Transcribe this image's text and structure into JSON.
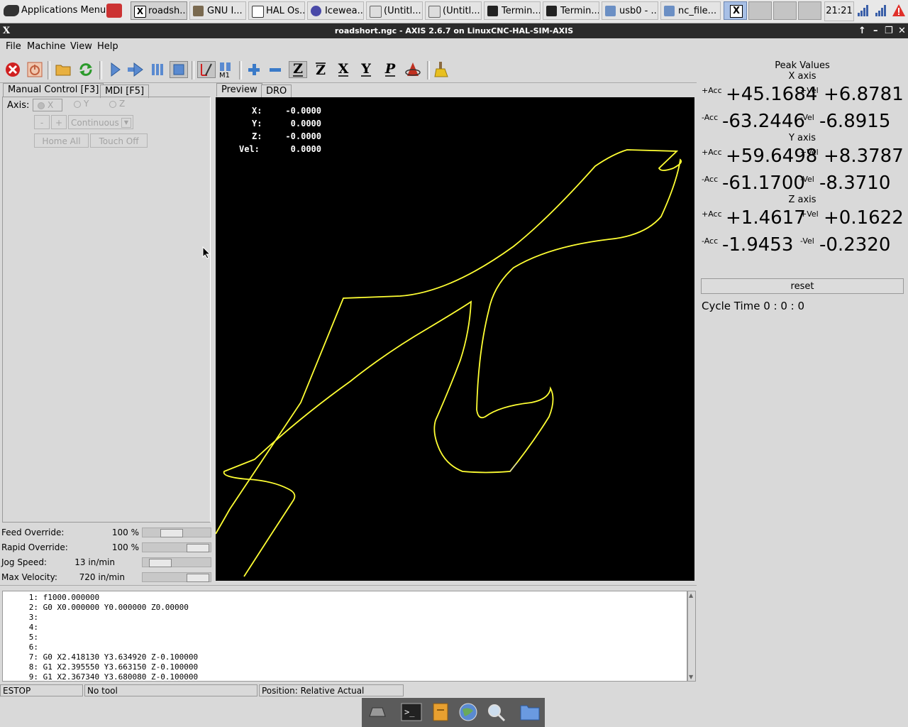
{
  "taskbar": {
    "app_menu": "Applications Menu",
    "tasks": [
      "roadsh...",
      "GNU I...",
      "HAL Os...",
      "Icewea...",
      "(Untitl...",
      "(Untitl...",
      "Termin...",
      "Termin...",
      "usb0 - ...",
      "nc_file..."
    ],
    "clock": "21:21"
  },
  "window": {
    "title": "roadshort.ngc - AXIS 2.6.7 on LinuxCNC-HAL-SIM-AXIS"
  },
  "menubar": {
    "file": "File",
    "machine": "Machine",
    "view": "View",
    "help": "Help"
  },
  "left": {
    "tab_manual": "Manual Control [F3]",
    "tab_mdi": "MDI [F5]",
    "axis_label": "Axis:",
    "axis_x": "X",
    "axis_y": "Y",
    "axis_z": "Z",
    "jog_minus": "-",
    "jog_plus": "+",
    "jog_mode": "Continuous",
    "home_all": "Home All",
    "touch_off": "Touch Off"
  },
  "sliders": {
    "feed_label": "Feed Override:",
    "feed_value": "100 %",
    "feed_level": 0.4,
    "rapid_label": "Rapid Override:",
    "rapid_value": "100 %",
    "rapid_level": 1.0,
    "jog_label": "Jog Speed:",
    "jog_value": "13 in/min",
    "jog_level": 0.15,
    "maxvel_label": "Max Velocity:",
    "maxvel_value": "720 in/min",
    "maxvel_level": 1.0
  },
  "preview": {
    "tab_preview": "Preview",
    "tab_dro": "DRO",
    "x_label": "X:",
    "x_value": "-0.0000",
    "y_label": "Y:",
    "y_value": "0.0000",
    "z_label": "Z:",
    "z_value": "-0.0000",
    "vel_label": "Vel:",
    "vel_value": "0.0000",
    "toolpath_color": "#ffff33"
  },
  "peak": {
    "title": "Peak Values",
    "axes": [
      {
        "name": "X axis",
        "pacc": "+45.1684",
        "pvel": "+6.8781",
        "nacc": "-63.2446",
        "nvel": "-6.8915"
      },
      {
        "name": "Y axis",
        "pacc": "+59.6498",
        "pvel": "+8.3787",
        "nacc": "-61.1700",
        "nvel": "-8.3710"
      },
      {
        "name": "Z axis",
        "pacc": "+1.4617",
        "pvel": "+0.1622",
        "nacc": "-1.9453",
        "nvel": "-0.2320"
      }
    ],
    "pacc_label": "+Acc",
    "pvel_label": "+Vel",
    "nacc_label": "-Acc",
    "nvel_label": "-Vel",
    "reset": "reset",
    "cycle_time": "Cycle Time  0 : 0 : 0"
  },
  "gcode": {
    "lines": [
      {
        "n": "1:",
        "text": "f1000.000000"
      },
      {
        "n": "2:",
        "text": "G0 X0.000000 Y0.000000 Z0.00000"
      },
      {
        "n": "3:",
        "text": ""
      },
      {
        "n": "4:",
        "text": ""
      },
      {
        "n": "5:",
        "text": ""
      },
      {
        "n": "6:",
        "text": ""
      },
      {
        "n": "7:",
        "text": "G0 X2.418130 Y3.634920 Z-0.100000"
      },
      {
        "n": "8:",
        "text": "G1 X2.395550 Y3.663150 Z-0.100000"
      },
      {
        "n": "9:",
        "text": "G1 X2.367340 Y3.680080 Z-0.100000"
      }
    ]
  },
  "status": {
    "estop": "ESTOP",
    "tool": "No tool",
    "position": "Position: Relative Actual"
  },
  "icons": {
    "estop": "estop-icon",
    "power": "power-icon",
    "open": "open-icon",
    "reload": "reload-icon",
    "run": "run-icon",
    "step": "step-icon",
    "pause": "pause-icon",
    "stop": "stop-icon"
  }
}
